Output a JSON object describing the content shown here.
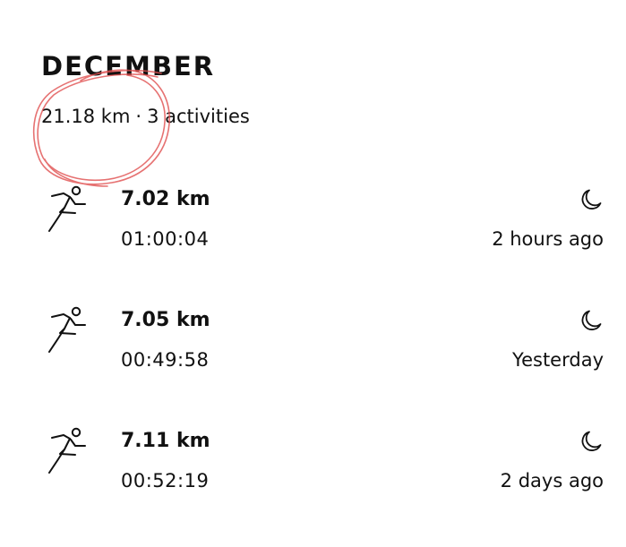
{
  "month": "DECEMBER",
  "summary": {
    "distance": "21.18 km",
    "separator": "·",
    "activities": "3 activities"
  },
  "annotation": {
    "color": "#e05050"
  },
  "activities": [
    {
      "distance": "7.02 km",
      "duration": "01:00:04",
      "when": "2 hours ago",
      "sport_icon": "running-icon",
      "time_icon": "moon-icon"
    },
    {
      "distance": "7.05 km",
      "duration": "00:49:58",
      "when": "Yesterday",
      "sport_icon": "running-icon",
      "time_icon": "moon-icon"
    },
    {
      "distance": "7.11 km",
      "duration": "00:52:19",
      "when": "2 days ago",
      "sport_icon": "running-icon",
      "time_icon": "moon-icon"
    }
  ]
}
